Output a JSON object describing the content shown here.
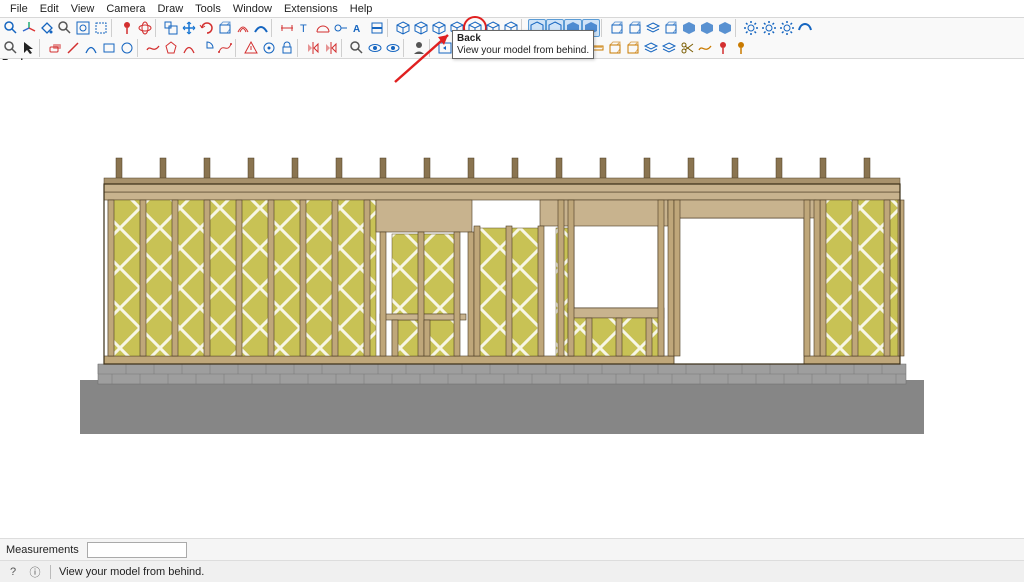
{
  "menu": {
    "items": [
      "File",
      "Edit",
      "View",
      "Camera",
      "Draw",
      "Tools",
      "Window",
      "Extensions",
      "Help"
    ]
  },
  "tooltip": {
    "title": "Back",
    "body": "View your model from behind."
  },
  "back_label": "Back",
  "measurements": {
    "label": "Measurements",
    "value": ""
  },
  "status": {
    "text": "View your model from behind."
  },
  "toolbar_row1": [
    {
      "name": "magnify-icon",
      "c": "#1565c0",
      "k": "mag"
    },
    {
      "name": "axes-icon",
      "c": "#d32f2f",
      "k": "axes"
    },
    {
      "name": "paint-icon",
      "c": "#1565c0",
      "k": "bucket"
    },
    {
      "name": "search-icon",
      "c": "#555",
      "k": "mag"
    },
    {
      "name": "zoom-extents-icon",
      "c": "#1565c0",
      "k": "zext"
    },
    {
      "name": "zoom-window-icon",
      "c": "#1565c0",
      "k": "zwin"
    },
    {
      "sep": true
    },
    {
      "name": "axis-red-icon",
      "c": "#d32f2f",
      "k": "pin"
    },
    {
      "name": "orbit-icon",
      "c": "#d32f2f",
      "k": "orbit"
    },
    {
      "sep": true
    },
    {
      "name": "scale-icon",
      "c": "#1565c0",
      "k": "scale"
    },
    {
      "name": "move-icon",
      "c": "#1976d2",
      "k": "move"
    },
    {
      "name": "rotate-icon",
      "c": "#d32f2f",
      "k": "rot"
    },
    {
      "name": "pushpull-icon",
      "c": "#1565c0",
      "k": "box"
    },
    {
      "name": "offset-icon",
      "c": "#d32f2f",
      "k": "off"
    },
    {
      "name": "followme-icon",
      "c": "#1565c0",
      "k": "fme"
    },
    {
      "sep": true
    },
    {
      "name": "dim-icon",
      "c": "#d32f2f",
      "k": "dim"
    },
    {
      "name": "text-icon",
      "c": "#1565c0",
      "k": "txt"
    },
    {
      "name": "protractor-icon",
      "c": "#d32f2f",
      "k": "prot"
    },
    {
      "name": "tape-icon",
      "c": "#1565c0",
      "k": "tape"
    },
    {
      "name": "3dtext-icon",
      "c": "#1565c0",
      "k": "3dt"
    },
    {
      "name": "section-icon",
      "c": "#1565c0",
      "k": "sect"
    },
    {
      "sep": true
    },
    {
      "name": "iso-view-icon",
      "c": "#1565c0",
      "k": "cubev"
    },
    {
      "name": "top-view-icon",
      "c": "#1565c0",
      "k": "cubev"
    },
    {
      "name": "front-view-icon",
      "c": "#1565c0",
      "k": "cubev"
    },
    {
      "name": "right-view-icon",
      "c": "#1565c0",
      "k": "cubev"
    },
    {
      "name": "back-view-icon",
      "c": "#1565c0",
      "k": "cubev",
      "circled": true
    },
    {
      "name": "left-view-icon",
      "c": "#1565c0",
      "k": "cubev"
    },
    {
      "name": "bottom-view-icon",
      "c": "#1565c0",
      "k": "cubev"
    },
    {
      "sep": true
    },
    {
      "name": "wireframe-icon",
      "c": "#1565c0",
      "k": "cube",
      "hl": true
    },
    {
      "name": "hidden-line-icon",
      "c": "#1565c0",
      "k": "cube",
      "hl": true
    },
    {
      "name": "shaded-icon",
      "c": "#1565c0",
      "k": "cubef",
      "hl": true
    },
    {
      "name": "texture-icon",
      "c": "#1565c0",
      "k": "cubef",
      "hl": true
    },
    {
      "sep": true
    },
    {
      "name": "box1-icon",
      "c": "#1565c0",
      "k": "box"
    },
    {
      "name": "box2-icon",
      "c": "#1565c0",
      "k": "box"
    },
    {
      "name": "layers-icon",
      "c": "#1565c0",
      "k": "lay"
    },
    {
      "name": "entity-info-icon",
      "c": "#1565c0",
      "k": "box"
    },
    {
      "name": "solid1-icon",
      "c": "#1565c0",
      "k": "cubef"
    },
    {
      "name": "solid2-icon",
      "c": "#1565c0",
      "k": "cubef"
    },
    {
      "name": "solid3-icon",
      "c": "#1565c0",
      "k": "cubef"
    },
    {
      "sep": true
    },
    {
      "name": "gear1-icon",
      "c": "#1565c0",
      "k": "gear"
    },
    {
      "name": "gear2-icon",
      "c": "#1565c0",
      "k": "gear"
    },
    {
      "name": "gear3-icon",
      "c": "#1565c0",
      "k": "gear"
    },
    {
      "name": "extension-icon",
      "c": "#1565c0",
      "k": "ext"
    }
  ],
  "toolbar_row2": [
    {
      "name": "zoom-icon",
      "c": "#555",
      "k": "mag"
    },
    {
      "name": "select-icon",
      "c": "#222",
      "k": "arrow"
    },
    {
      "sep": true
    },
    {
      "name": "eraser-icon",
      "c": "#d32f2f",
      "k": "era"
    },
    {
      "name": "line-icon",
      "c": "#d32f2f",
      "k": "line"
    },
    {
      "name": "arc-icon",
      "c": "#1565c0",
      "k": "arc"
    },
    {
      "name": "rect-icon",
      "c": "#1565c0",
      "k": "rect"
    },
    {
      "name": "circle-icon",
      "c": "#1565c0",
      "k": "circ"
    },
    {
      "sep": true
    },
    {
      "name": "freehand-icon",
      "c": "#d32f2f",
      "k": "free"
    },
    {
      "name": "polygon-icon",
      "c": "#d32f2f",
      "k": "poly"
    },
    {
      "name": "2pt-arc-icon",
      "c": "#d32f2f",
      "k": "arc"
    },
    {
      "name": "pie-icon",
      "c": "#1565c0",
      "k": "pie"
    },
    {
      "name": "bezier-icon",
      "c": "#d32f2f",
      "k": "bez"
    },
    {
      "sep": true
    },
    {
      "name": "warn-icon",
      "c": "#d32f2f",
      "k": "warn"
    },
    {
      "name": "target-icon",
      "c": "#1565c0",
      "k": "tgt"
    },
    {
      "name": "lock-icon",
      "c": "#1565c0",
      "k": "lock"
    },
    {
      "sep": true
    },
    {
      "name": "flip1-icon",
      "c": "#d32f2f",
      "k": "flip"
    },
    {
      "name": "flip2-icon",
      "c": "#d32f2f",
      "k": "flip"
    },
    {
      "sep": true
    },
    {
      "name": "tool-zoom-icon",
      "c": "#555",
      "k": "mag"
    },
    {
      "name": "walk-icon",
      "c": "#1565c0",
      "k": "eye"
    },
    {
      "name": "look-icon",
      "c": "#1565c0",
      "k": "eye"
    },
    {
      "sep": true
    },
    {
      "name": "profile-icon",
      "c": "#555",
      "k": "prof"
    },
    {
      "sep": true
    },
    {
      "name": "previous-scene-icon",
      "c": "#1565c0",
      "k": "prev"
    },
    {
      "name": "next-scene-icon",
      "c": "#1565c0",
      "k": "next"
    },
    {
      "sep": true
    },
    {
      "name": "ext-pencil-icon",
      "c": "#7a5c00",
      "k": "pnc"
    },
    {
      "name": "ext-pencil2-icon",
      "c": "#7a5c00",
      "k": "pnc"
    },
    {
      "name": "ext-sheet-icon",
      "c": "#1565c0",
      "k": "sht",
      "hl": true
    },
    {
      "name": "ext-clip-icon",
      "c": "#1565c0",
      "k": "clip",
      "hl": true
    },
    {
      "name": "ext-bar1-icon",
      "c": "#c97a00",
      "k": "bar"
    },
    {
      "name": "ext-bar2-icon",
      "c": "#c97a00",
      "k": "bar"
    },
    {
      "name": "ext-ruler-icon",
      "c": "#c97a00",
      "k": "rul"
    },
    {
      "name": "ext-box-icon",
      "c": "#c97a00",
      "k": "box"
    },
    {
      "name": "ext-box2-icon",
      "c": "#c97a00",
      "k": "box"
    },
    {
      "name": "ext-layer-icon",
      "c": "#1565c0",
      "k": "lay"
    },
    {
      "name": "ext-layer2-icon",
      "c": "#1565c0",
      "k": "lay"
    },
    {
      "name": "ext-scissors-icon",
      "c": "#7a5c00",
      "k": "scis"
    },
    {
      "name": "ext-curve-icon",
      "c": "#c97a00",
      "k": "free"
    },
    {
      "name": "ext-mark1-icon",
      "c": "#d32f2f",
      "k": "pin"
    },
    {
      "name": "ext-mark2-icon",
      "c": "#c97a00",
      "k": "pin"
    }
  ],
  "insulation_color": "#c8c255",
  "stud_color": "#bfa77a",
  "header_color": "#c8b38e"
}
